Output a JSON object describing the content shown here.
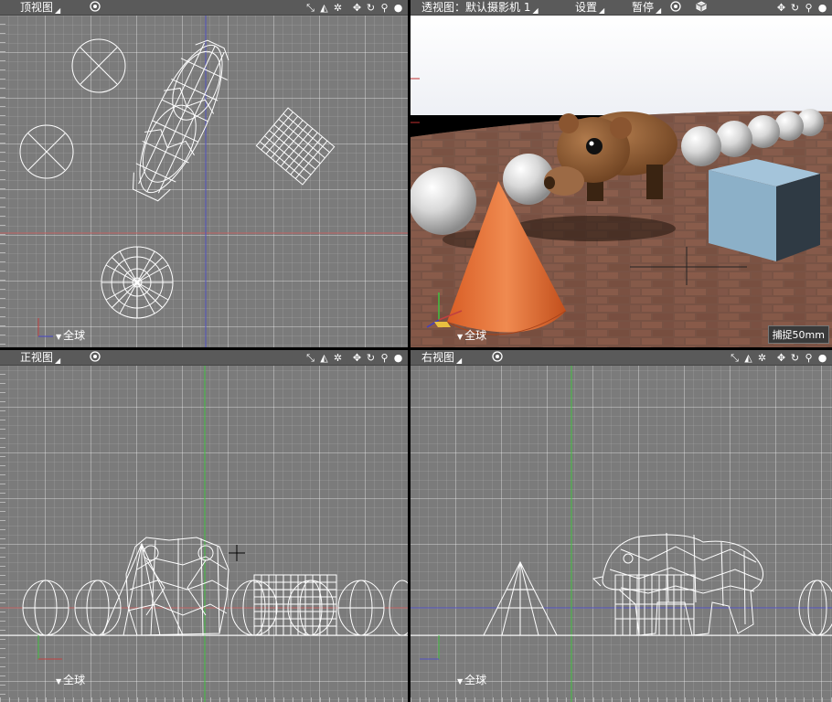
{
  "top_view": {
    "title": "顶视图",
    "scope_label": "全球"
  },
  "perspective_view": {
    "title": "透视图：默认摄影机 1",
    "settings_label": "设置",
    "pause_label": "暂停",
    "scope_label": "全球",
    "capture_label": "捕捉50mm"
  },
  "front_view": {
    "title": "正视图",
    "scope_label": "全球"
  },
  "right_view": {
    "title": "右视图",
    "scope_label": "全球"
  },
  "icons": {
    "camera_toggle": "target-icon",
    "object_mode": "cube-icon",
    "tools": [
      "fit-icon",
      "render-mode-icon",
      "settings-gear-icon",
      "pan-icon",
      "rotate-icon",
      "zoom-icon",
      "sphere-view-icon"
    ]
  },
  "colors": {
    "viewport_bg": "#7b7b7b",
    "titlebar_bg": "#5a5a5a",
    "cone": "#e06a30",
    "cube": "#8cb0c8",
    "bear": "#8a5530",
    "axis_red": "#c04040",
    "axis_green": "#40c040",
    "axis_blue": "#4040c0"
  }
}
